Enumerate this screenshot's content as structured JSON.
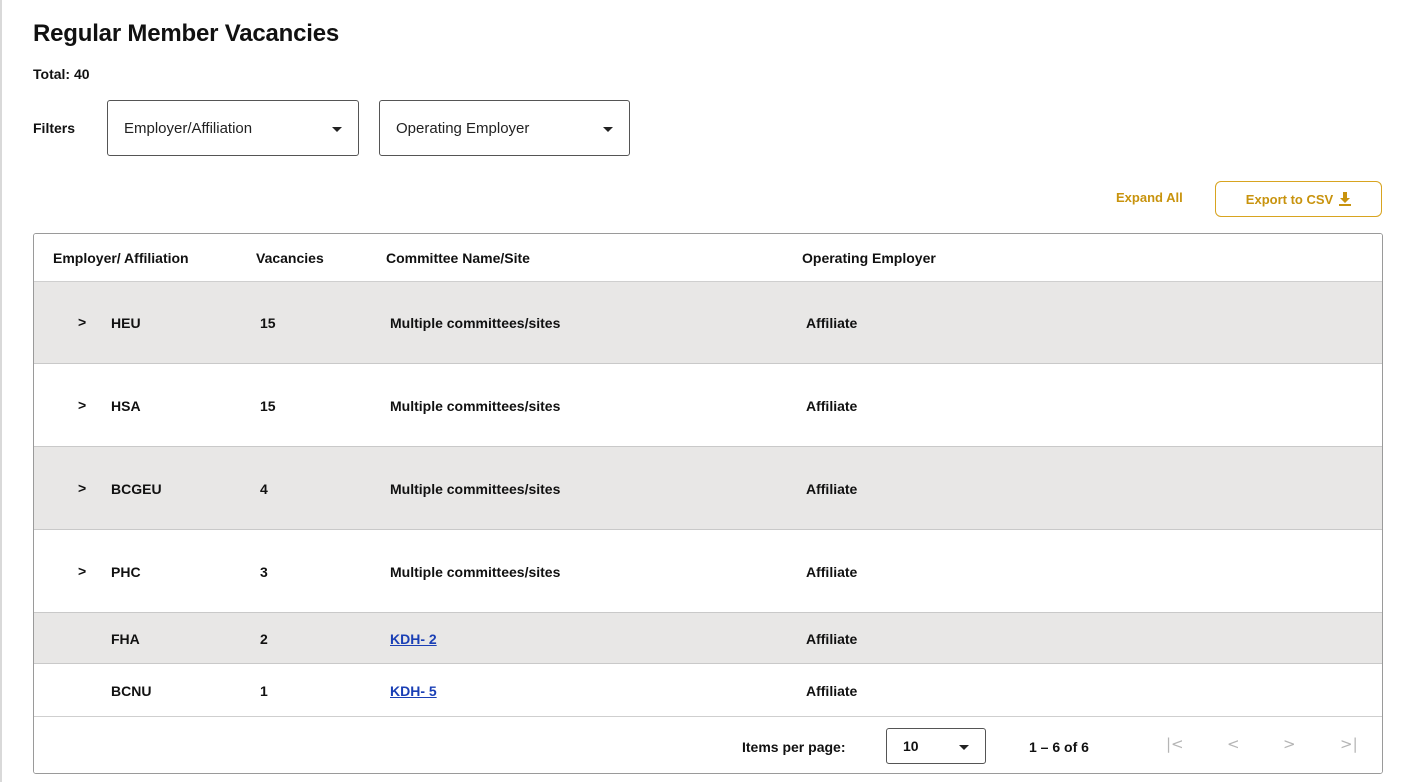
{
  "page": {
    "title": "Regular Member Vacancies",
    "total": "Total: 40"
  },
  "filters": {
    "label": "Filters",
    "employer_affiliation": "Employer/Affiliation",
    "operating_employer": "Operating Employer"
  },
  "actions": {
    "expand_all": "Expand All",
    "export_csv": "Export to CSV"
  },
  "table": {
    "headers": [
      "Employer/ Affiliation",
      "Vacancies",
      "Committee Name/Site",
      "Operating Employer"
    ],
    "rows": [
      {
        "employer": "HEU",
        "vacancies": "15",
        "committee": "Multiple committees/sites",
        "operating": "Affiliate",
        "expandable": true
      },
      {
        "employer": "HSA",
        "vacancies": "15",
        "committee": "Multiple committees/sites",
        "operating": "Affiliate",
        "expandable": true
      },
      {
        "employer": "BCGEU",
        "vacancies": "4",
        "committee": "Multiple committees/sites",
        "operating": "Affiliate",
        "expandable": true
      },
      {
        "employer": "PHC",
        "vacancies": "3",
        "committee": "Multiple committees/sites",
        "operating": "Affiliate",
        "expandable": true
      },
      {
        "employer": "FHA",
        "vacancies": "2",
        "committee": "KDH- 2",
        "operating": "Affiliate",
        "expandable": false
      },
      {
        "employer": "BCNU",
        "vacancies": "1",
        "committee": "KDH- 5",
        "operating": "Affiliate",
        "expandable": false
      }
    ]
  },
  "paginator": {
    "items_per_page_label": "Items per page:",
    "items_per_page_value": "10",
    "range": "1 – 6 of 6",
    "first_icon": "first-page-icon",
    "prev_icon": "prev-page-icon",
    "next_icon": "next-page-icon",
    "last_icon": "last-page-icon"
  },
  "colors": {
    "accent": "#c8930d",
    "link": "#1a3fb5",
    "row_shade": "#e8e7e6"
  }
}
